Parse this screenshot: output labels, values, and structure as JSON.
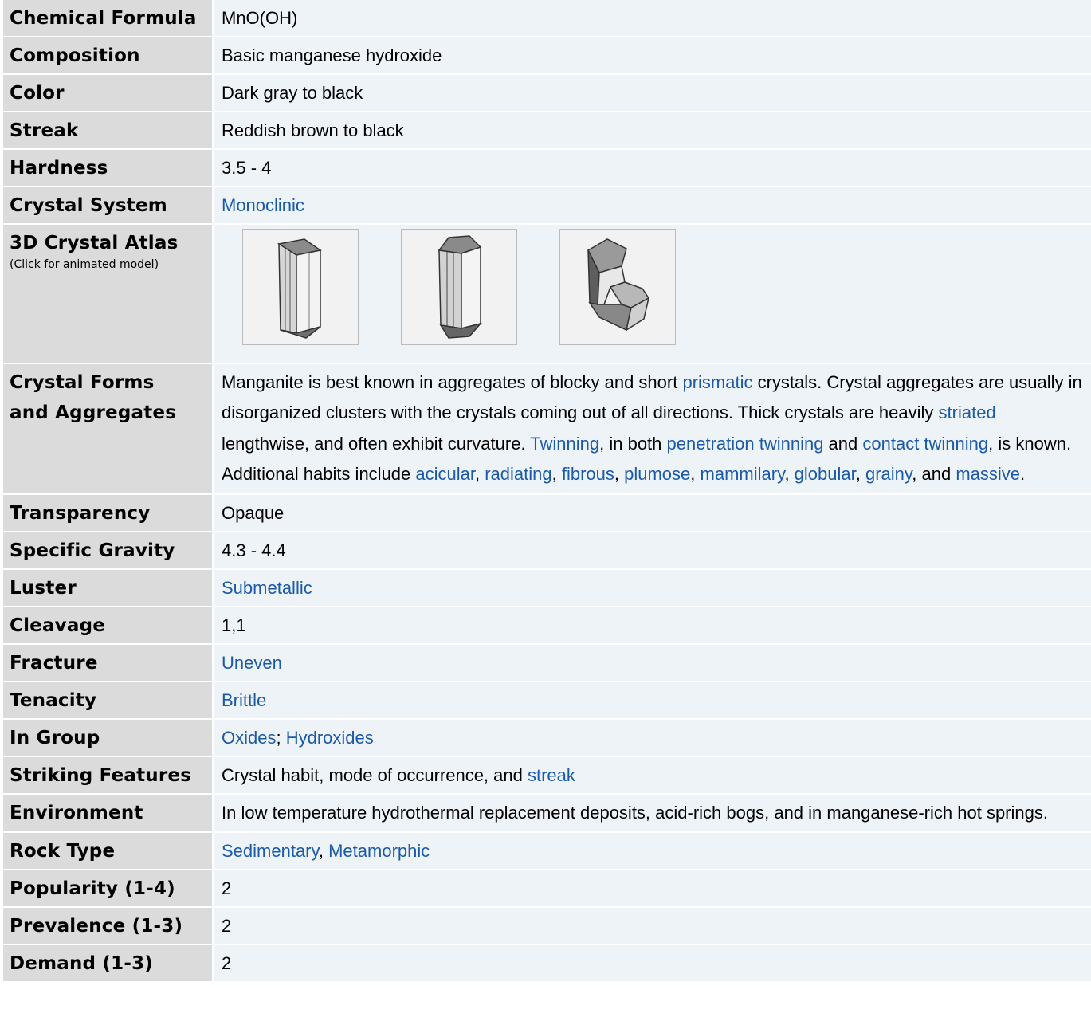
{
  "rows": [
    {
      "label": "Chemical Formula",
      "value": "MnO(OH)"
    },
    {
      "label": "Composition",
      "value": "Basic manganese hydroxide"
    },
    {
      "label": "Color",
      "value": "Dark gray to black"
    },
    {
      "label": "Streak",
      "value": "Reddish brown to black"
    },
    {
      "label": "Hardness",
      "value": "3.5 - 4"
    },
    {
      "label": "Crystal System",
      "link": "Monoclinic"
    }
  ],
  "atlas": {
    "label": "3D Crystal Atlas",
    "note": "(Click for animated model)",
    "models": [
      "crystal-model-1",
      "crystal-model-2",
      "crystal-model-3"
    ]
  },
  "forms": {
    "label1": "Crystal Forms",
    "label2": "and Aggregates",
    "t1": "Manganite is best known in aggregates of blocky and short ",
    "l1": "prismatic",
    "t2": " crystals. Crystal aggregates are usually in disorganized clusters with the crystals coming out of all directions. Thick crystals are heavily ",
    "l2": "striated",
    "t3": " lengthwise, and often exhibit curvature. ",
    "l3": "Twinning",
    "t4": ", in both ",
    "l4": "penetration twinning",
    "t5": " and ",
    "l5": "contact twinning",
    "t6": ", is known. Additional habits include ",
    "l6": "acicular",
    "t7": ", ",
    "l7": "radiating",
    "t8": ", ",
    "l8": "fibrous",
    "t9": ", ",
    "l9": "plumose",
    "t10": ", ",
    "l10": "mammilary",
    "t11": ", ",
    "l11": "globular",
    "t12": ", ",
    "l12": "grainy",
    "t13": ", and ",
    "l13": "massive",
    "t14": "."
  },
  "rows2": [
    {
      "label": "Transparency",
      "value": "Opaque"
    },
    {
      "label": "Specific Gravity",
      "value": "4.3 - 4.4"
    },
    {
      "label": "Luster",
      "link": "Submetallic"
    },
    {
      "label": "Cleavage",
      "value": "1,1"
    },
    {
      "label": "Fracture",
      "link": "Uneven"
    },
    {
      "label": "Tenacity",
      "link": "Brittle"
    }
  ],
  "group": {
    "label": "In Group",
    "link1": "Oxides",
    "sep": "; ",
    "link2": "Hydroxides"
  },
  "striking": {
    "label": "Striking Features",
    "text": "Crystal habit, mode of occurrence, and ",
    "link": "streak"
  },
  "environment": {
    "label": "Environment",
    "text": "In low temperature hydrothermal replacement deposits, acid-rich bogs, and in manganese-rich hot springs."
  },
  "rock": {
    "label": "Rock Type",
    "link1": "Sedimentary",
    "sep": ", ",
    "link2": "Metamorphic"
  },
  "rows3": [
    {
      "label": "Popularity (1-4)",
      "value": "2"
    },
    {
      "label": "Prevalence (1-3)",
      "value": "2"
    },
    {
      "label": "Demand (1-3)",
      "value": "2"
    }
  ]
}
